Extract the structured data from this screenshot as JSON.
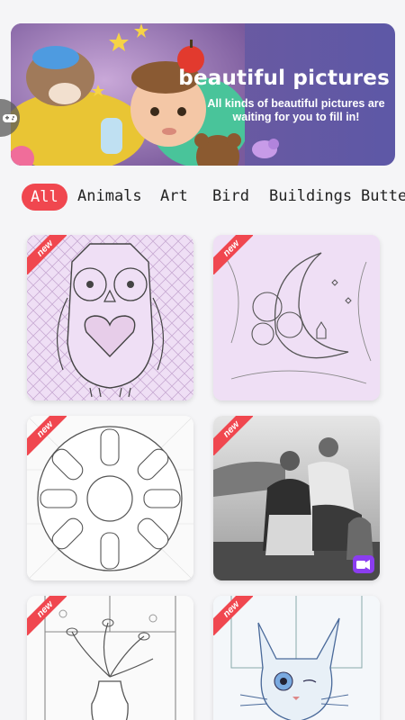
{
  "banner": {
    "title": "beautiful pictures",
    "subtitle": "All kinds of beautiful pictures are waiting for you to fill in!"
  },
  "tabs": [
    {
      "label": "All",
      "active": true
    },
    {
      "label": "Animals",
      "active": false
    },
    {
      "label": "Art",
      "active": false
    },
    {
      "label": "Bird",
      "active": false
    },
    {
      "label": "Buildings",
      "active": false
    },
    {
      "label": "Butter",
      "active": false
    }
  ],
  "cards": [
    {
      "badge": "new",
      "subject": "owl"
    },
    {
      "badge": "new",
      "subject": "moon-flowers-cat"
    },
    {
      "badge": "new",
      "subject": "ice-cream-mandala"
    },
    {
      "badge": "new",
      "subject": "women-photo",
      "has_video": true
    },
    {
      "badge": "new",
      "subject": "vase-window"
    },
    {
      "badge": "new",
      "subject": "sphynx-cat"
    }
  ],
  "colors": {
    "accent": "#f0474f",
    "banner_purple": "#6d5aa0",
    "card_pink": "#efdff5",
    "video_purple": "#8b3df0"
  }
}
